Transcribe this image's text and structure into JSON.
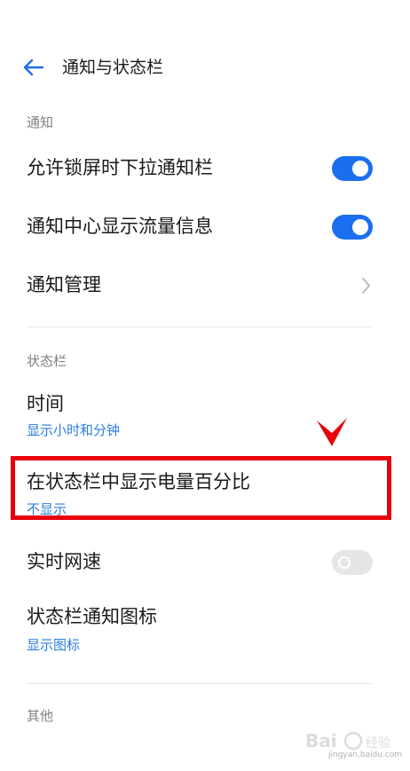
{
  "header": {
    "title": "通知与状态栏",
    "back_icon": "arrow-left-icon"
  },
  "sections": {
    "notification": {
      "label": "通知",
      "items": [
        {
          "title": "允许锁屏时下拉通知栏",
          "control": "toggle",
          "state": "on"
        },
        {
          "title": "通知中心显示流量信息",
          "control": "toggle",
          "state": "on"
        },
        {
          "title": "通知管理",
          "control": "chevron"
        }
      ]
    },
    "status_bar": {
      "label": "状态栏",
      "items": [
        {
          "title": "时间",
          "subtitle": "显示小时和分钟"
        },
        {
          "title": "在状态栏中显示电量百分比",
          "subtitle": "不显示"
        },
        {
          "title": "实时网速",
          "control": "toggle",
          "state": "off"
        },
        {
          "title": "状态栏通知图标",
          "subtitle": "显示图标"
        }
      ]
    },
    "other": {
      "label": "其他"
    }
  },
  "annotation": {
    "highlight_color": "#e8000c",
    "arrow_icon": "down-arrow-mark-icon"
  },
  "colors": {
    "accent": "#1a6ff0",
    "subtitle": "#2a7de1",
    "section_label": "#808080",
    "toggle_off": "#e6e6e6"
  },
  "watermark": {
    "text": "jingyan.baidu.com"
  }
}
